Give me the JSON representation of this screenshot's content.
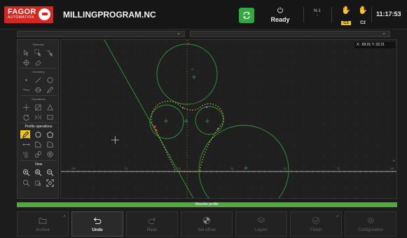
{
  "header": {
    "logo_text": "FAGOR",
    "logo_sub": "AUTOMATION",
    "program_name": "MILLINGPROGRAM.NC",
    "sync_icon": "sync-icon",
    "status_icon": "power-icon",
    "status": "Ready",
    "channel": "N-1",
    "channel_sub": "-",
    "channels": [
      {
        "label": "C1",
        "icon": "hand-icon",
        "active": true
      },
      {
        "label": "C2",
        "icon": "hand-icon",
        "active": false
      }
    ],
    "time": "11:17:53"
  },
  "colors": {
    "accent_red": "#d8261f",
    "sync_green": "#2eaa3e",
    "active_yellow": "#f0c419",
    "geometry_green": "#2f9a3a",
    "progress_green": "#53a93f"
  },
  "tool_panel": {
    "sections": [
      {
        "label": "Selection",
        "icons": [
          "select-point-icon",
          "select-window-icon",
          "select-chain-icon",
          "snap-icon",
          "eraser-icon"
        ]
      },
      {
        "label": "Geometry",
        "icons": [
          "point-icon",
          "line-icon",
          "circle-icon",
          "tangent-line-icon",
          "circle-tangent-icon",
          "pencil-icon"
        ]
      },
      {
        "label": "Operations",
        "icons": [
          "move-icon",
          "trim-icon",
          "scale-icon",
          "rotate-icon",
          "symmetry-icon",
          "rectangle-icon"
        ]
      },
      {
        "label": "Profile operations",
        "icons": [
          "pencil-profile-icon",
          "circle-profile-icon",
          "polygon-profile-icon",
          "linear-pattern-icon",
          "chamfer-icon",
          "round-icon",
          "iso-icon",
          "reverse-icon",
          "link-icon"
        ]
      },
      {
        "label": "View",
        "icons": [
          "zoom-in-icon",
          "zoom-all-icon",
          "zoom-out-icon",
          "zoom-window-icon",
          "zoom-previous-icon",
          "zoom-fit-icon"
        ]
      }
    ]
  },
  "canvas": {
    "coords": "X: -59.01   Y: 32.21",
    "axis_labels": [
      "-100",
      "-75",
      "-50",
      "-25",
      "0",
      "25",
      "50",
      "75",
      "100",
      "125",
      "150"
    ],
    "y_label": "Y",
    "x_label": "X",
    "y_tick_label": "150"
  },
  "progress": {
    "label": "Resolve profile",
    "fraction": 1.0
  },
  "softkeys": [
    {
      "label": "Archive",
      "icon": "folder-icon",
      "enabled": false
    },
    {
      "label": "Undo",
      "icon": "undo-icon",
      "enabled": true
    },
    {
      "label": "Redo",
      "icon": "redo-icon",
      "enabled": false
    },
    {
      "label": "Set offset",
      "icon": "offset-icon",
      "enabled": false
    },
    {
      "label": "Layers",
      "icon": "layers-icon",
      "enabled": false
    },
    {
      "label": "Finish",
      "icon": "check-icon",
      "enabled": false
    },
    {
      "label": "Configuration",
      "icon": "gear-icon",
      "enabled": false
    }
  ]
}
